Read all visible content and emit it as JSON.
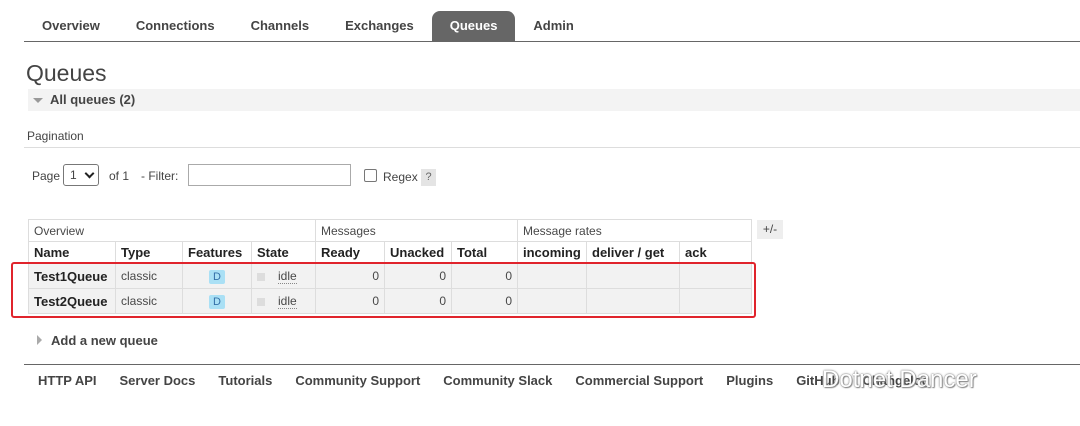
{
  "nav": {
    "tabs": [
      {
        "label": "Overview",
        "active": false
      },
      {
        "label": "Connections",
        "active": false
      },
      {
        "label": "Channels",
        "active": false
      },
      {
        "label": "Exchanges",
        "active": false
      },
      {
        "label": "Queues",
        "active": true
      },
      {
        "label": "Admin",
        "active": false
      }
    ]
  },
  "page": {
    "title": "Queues",
    "section_label": "All queues (2)"
  },
  "pagination": {
    "label": "Pagination",
    "page_text": "Page",
    "page_value": "1",
    "of_text": "of 1",
    "filter_text": "- Filter:",
    "filter_value": "",
    "regex_label": "Regex",
    "regex_checked": false,
    "help": "?"
  },
  "table": {
    "groups": [
      "Overview",
      "Messages",
      "Message rates"
    ],
    "columns": [
      "Name",
      "Type",
      "Features",
      "State",
      "Ready",
      "Unacked",
      "Total",
      "incoming",
      "deliver / get",
      "ack"
    ],
    "rows": [
      {
        "name": "Test1Queue",
        "type": "classic",
        "feature": "D",
        "state": "idle",
        "ready": "0",
        "unacked": "0",
        "total": "0",
        "incoming": "",
        "deliver_get": "",
        "ack": ""
      },
      {
        "name": "Test2Queue",
        "type": "classic",
        "feature": "D",
        "state": "idle",
        "ready": "0",
        "unacked": "0",
        "total": "0",
        "incoming": "",
        "deliver_get": "",
        "ack": ""
      }
    ],
    "toggle_columns": "+/-"
  },
  "add_queue": "Add a new queue",
  "footer": {
    "links": [
      "HTTP API",
      "Server Docs",
      "Tutorials",
      "Community Support",
      "Community Slack",
      "Commercial Support",
      "Plugins",
      "GitHub",
      "Changelog"
    ]
  },
  "watermark": "Dotnet Dancer",
  "colors": {
    "active_tab": "#666666",
    "highlight": "#e0242c",
    "feature_badge": "#aae0f5"
  }
}
